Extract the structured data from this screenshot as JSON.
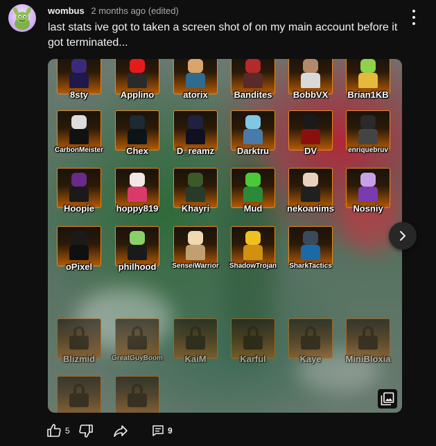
{
  "comment": {
    "author": "wombus",
    "meta": "2 months ago (edited)",
    "text": "last stats ive got to taken a screen shot of on my main account before it got terminated..."
  },
  "actions": {
    "like_count": "5",
    "reply_count": "9"
  },
  "icons": {
    "avatar": "avatar",
    "more": "more-vert-icon",
    "next": "chevron-right-icon",
    "gallery": "image-gallery-icon",
    "like": "thumb-up-icon",
    "dislike": "thumb-down-icon",
    "share": "share-icon",
    "reply": "comment-icon"
  },
  "colors": {
    "background": "#0f0f0f",
    "tile_border": "#e78a1e",
    "tile_bottom": "#b25a06"
  },
  "gallery": {
    "unlocked": [
      {
        "name": "8sty",
        "head": "#3a2b7a",
        "body": "#20174a"
      },
      {
        "name": "Applino",
        "head": "#e51b1b",
        "body": "#2a2a2a"
      },
      {
        "name": "atorix",
        "head": "#d9a56b",
        "body": "#2e6b8f"
      },
      {
        "name": "Bandites",
        "head": "#b32a2a",
        "body": "#5a2a2a"
      },
      {
        "name": "BobbVX",
        "head": "#b08a6b",
        "body": "#d9d9d9"
      },
      {
        "name": "Brian1KB",
        "head": "#8fd14a",
        "body": "#e7b93a"
      },
      {
        "name": "CarbonMeister",
        "head": "#dcdcdc",
        "body": "#111111"
      },
      {
        "name": "Chex",
        "head": "#1d2a33",
        "body": "#0c1418"
      },
      {
        "name": "D_reamz",
        "head": "#202040",
        "body": "#101020"
      },
      {
        "name": "Darktru",
        "head": "#7ec8e3",
        "body": "#4a7aa8"
      },
      {
        "name": "DV",
        "head": "#1a1a1a",
        "body": "#8a1010"
      },
      {
        "name": "enriquebruv",
        "head": "#2a2a2a",
        "body": "#444444"
      },
      {
        "name": "Hoopie",
        "head": "#6a2a8a",
        "body": "#1a1a1a"
      },
      {
        "name": "hoppy819",
        "head": "#f2e6e6",
        "body": "#d93a6a"
      },
      {
        "name": "Khayri",
        "head": "#3a5a2a",
        "body": "#2a3a2a"
      },
      {
        "name": "Mud",
        "head": "#4ac93a",
        "body": "#2a8a3a"
      },
      {
        "name": "nekoanims",
        "head": "#e8d0c0",
        "body": "#202020"
      },
      {
        "name": "Nosniy",
        "head": "#c8a0e8",
        "body": "#7a3ab0"
      },
      {
        "name": "oPixel",
        "head": "#1a1a1a",
        "body": "#101010"
      },
      {
        "name": "philhood",
        "head": "#8ad06a",
        "body": "#1a1a1a"
      },
      {
        "name": "SenseiWarrior",
        "head": "#f0d8b0",
        "body": "#c0a070"
      },
      {
        "name": "ShadowTrojan",
        "head": "#f0c020",
        "body": "#d09010"
      },
      {
        "name": "SharkTactics",
        "head": "#3a4a5a",
        "body": "#1a6aa8"
      }
    ],
    "locked": [
      {
        "name": "Blizmid"
      },
      {
        "name": "GreatGuyBoom"
      },
      {
        "name": "KaiM"
      },
      {
        "name": "Karful"
      },
      {
        "name": "Kaye"
      },
      {
        "name": "MiniBloxia"
      },
      {
        "name": ""
      },
      {
        "name": ""
      }
    ]
  }
}
